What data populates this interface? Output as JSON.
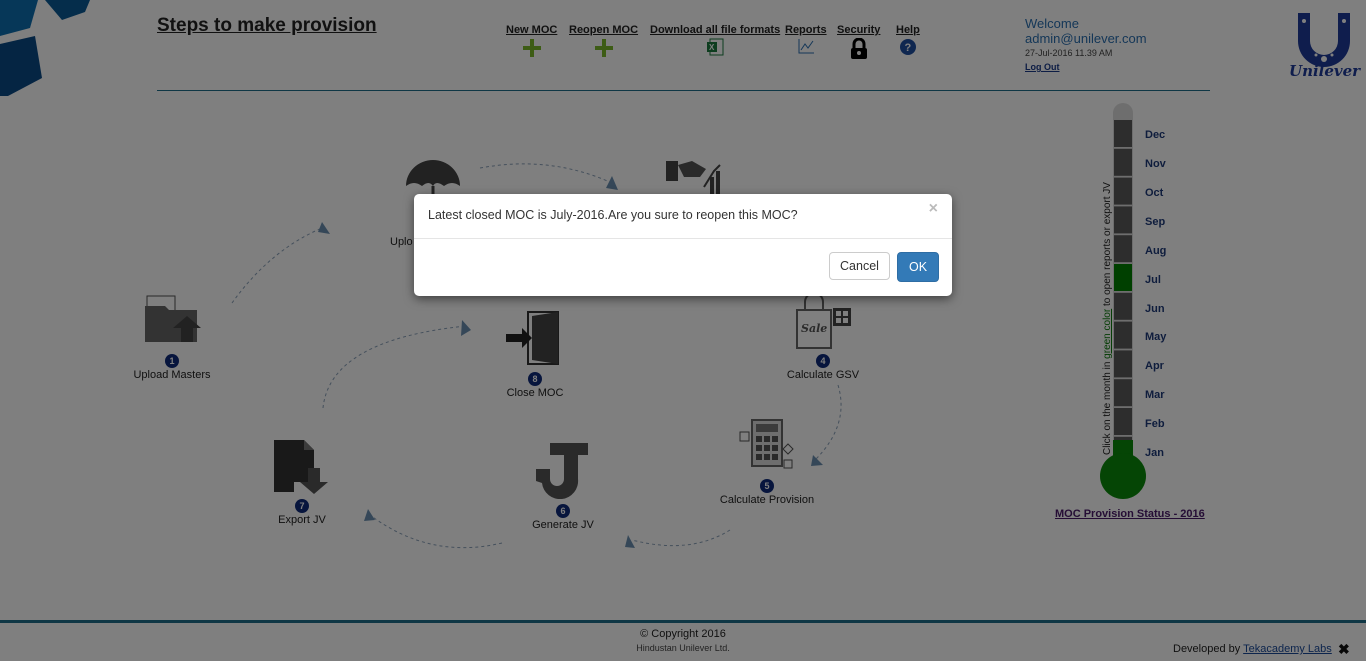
{
  "header": {
    "title": "Steps to make provision",
    "nav": [
      {
        "label": "New MOC",
        "icon": "plus-icon"
      },
      {
        "label": "Reopen MOC",
        "icon": "plus-icon"
      },
      {
        "label": "Download all file formats",
        "icon": "excel-icon"
      },
      {
        "label": "Reports",
        "icon": "chart-icon"
      },
      {
        "label": "Security",
        "icon": "lock-icon"
      },
      {
        "label": "Help",
        "icon": "question-icon"
      }
    ]
  },
  "user": {
    "welcome": "Welcome",
    "email": "admin@unilever.com",
    "datetime": "27-Jul-2016 11.39 AM",
    "logout": "Log Out"
  },
  "logo": {
    "text": "Unilever"
  },
  "steps": [
    {
      "num": "1",
      "label": "Upload Masters"
    },
    {
      "num": "",
      "label": "Uplo"
    },
    {
      "num": "4",
      "label": "Calculate GSV"
    },
    {
      "num": "5",
      "label": "Calculate Provision"
    },
    {
      "num": "6",
      "label": "Generate JV"
    },
    {
      "num": "7",
      "label": "Export JV"
    },
    {
      "num": "8",
      "label": "Close MOC"
    }
  ],
  "moc_status": {
    "title": "MOC Provision Status - 2016",
    "note_prefix": "Click on the month in ",
    "note_green": "green color",
    "note_suffix": " to open reports or export JV",
    "months": [
      "Dec",
      "Nov",
      "Oct",
      "Sep",
      "Aug",
      "Jul",
      "Jun",
      "May",
      "Apr",
      "Mar",
      "Feb",
      "Jan"
    ],
    "active_month": "Jul",
    "active_color": "#008000"
  },
  "footer": {
    "copyright": "© Copyright 2016",
    "company": "Hindustan Unilever Ltd.",
    "developed_prefix": "Developed by ",
    "developed_link": "Tekacademy Labs"
  },
  "modal": {
    "message": "Latest closed MOC is July-2016.Are you sure to reopen this MOC?",
    "close": "×",
    "cancel": "Cancel",
    "ok": "OK"
  }
}
